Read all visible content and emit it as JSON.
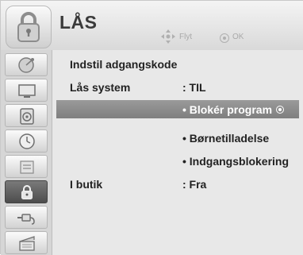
{
  "header": {
    "title": "LÅS",
    "hint_move": "Flyt",
    "hint_ok": "OK"
  },
  "sidebar": {
    "items": [
      {
        "icon": "satellite-dish-icon"
      },
      {
        "icon": "monitor-icon"
      },
      {
        "icon": "speaker-icon"
      },
      {
        "icon": "clock-icon"
      },
      {
        "icon": "options-icon"
      },
      {
        "icon": "lock-icon",
        "active": true
      },
      {
        "icon": "cable-plug-icon"
      },
      {
        "icon": "media-clapper-icon"
      }
    ]
  },
  "menu": {
    "set_password": "Indstil adgangskode",
    "lock_system_label": "Lås system",
    "lock_system_value": ": TIL",
    "block_program": "• Blokér program",
    "parental_guidance": "• Børnetilladelse",
    "input_block": "• Indgangsblokering",
    "in_store_label": "I butik",
    "in_store_value": ": Fra"
  },
  "colors": {
    "highlight": "#8a8a8a",
    "active_sidebar": "#5a5a5a",
    "text": "#222222"
  }
}
